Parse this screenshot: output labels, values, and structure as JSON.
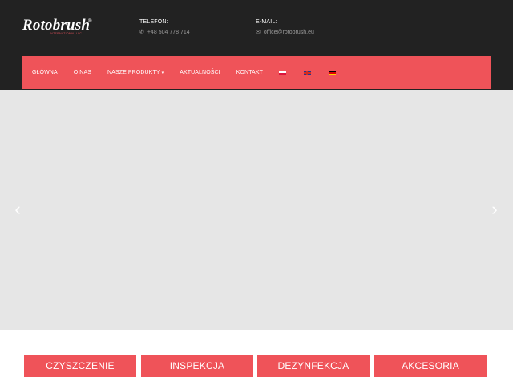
{
  "brand": {
    "name": "Rotobrush",
    "registered": "®",
    "tagline": "INTERNATIONAL LLC"
  },
  "contact": {
    "phone_label": "TELEFON:",
    "phone_value": "+48 504 778 714",
    "email_label": "E-MAIL:",
    "email_value": "office@rotobrush.eu"
  },
  "nav": {
    "items": [
      {
        "label": "GŁÓWNA"
      },
      {
        "label": "O NAS"
      },
      {
        "label": "NASZE PRODUKTY"
      },
      {
        "label": "AKTUALNOŚCI"
      },
      {
        "label": "KONTAKT"
      }
    ],
    "dropdown_caret": "▾",
    "languages": [
      "pl-flag",
      "uk-flag",
      "de-flag"
    ]
  },
  "slider": {
    "prev": "‹",
    "next": "›"
  },
  "categories": [
    {
      "label": "CZYSZCZENIE"
    },
    {
      "label": "INSPEKCJA"
    },
    {
      "label": "DEZYNFEKCJA"
    },
    {
      "label": "AKCESORIA"
    }
  ],
  "colors": {
    "accent": "#ef5359",
    "header_bg": "#222222",
    "slider_bg": "#e6e6e6"
  }
}
